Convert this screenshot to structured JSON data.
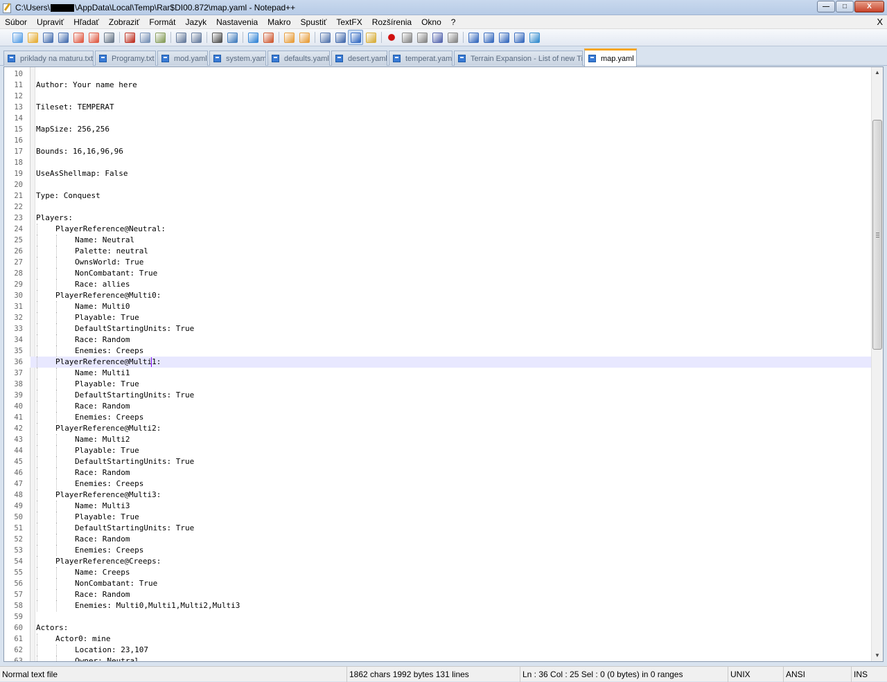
{
  "window": {
    "title_prefix": "C:\\Users\\",
    "title_suffix": "\\AppData\\Local\\Temp\\Rar$DI00.872\\map.yaml - Notepad++",
    "buttons": [
      "—",
      "□",
      "X"
    ]
  },
  "menu": {
    "items": [
      "Súbor",
      "Upraviť",
      "Hľadať",
      "Zobraziť",
      "Formát",
      "Jazyk",
      "Nastavenia",
      "Makro",
      "Spustiť",
      "TextFX",
      "Rozšírenia",
      "Okno",
      "?"
    ],
    "close_label": "X"
  },
  "toolbar": {
    "icons": [
      "new-file-icon",
      "open-file-icon",
      "save-icon",
      "save-all-icon",
      "close-icon",
      "close-all-icon",
      "print-icon",
      "cut-icon",
      "copy-icon",
      "paste-icon",
      "undo-icon",
      "redo-icon",
      "find-icon",
      "replace-icon",
      "zoom-in-icon",
      "zoom-out-icon",
      "sync-vertical-icon",
      "sync-horizontal-icon",
      "word-wrap-icon",
      "show-all-chars-icon",
      "indent-guide-icon",
      "function-list-icon",
      "record-macro-icon",
      "stop-record-icon",
      "play-macro-icon",
      "run-macro-multiple-icon",
      "save-macro-icon",
      "fold-all-icon",
      "prev-bookmark-icon",
      "next-bookmark-icon",
      "unfold-all-icon",
      "spellcheck-icon"
    ],
    "colors": {
      "accent": "#f5a623",
      "tab_icon": "#3a7bd5",
      "current_line": "#e8e8ff",
      "caret": "#8000ff"
    }
  },
  "tabs": [
    {
      "label": "priklady na maturu.txt",
      "active": false
    },
    {
      "label": "Programy.txt",
      "active": false
    },
    {
      "label": "mod.yaml",
      "active": false
    },
    {
      "label": "system.yaml",
      "active": false
    },
    {
      "label": "defaults.yaml",
      "active": false
    },
    {
      "label": "desert.yaml",
      "active": false
    },
    {
      "label": "temperat.yaml",
      "active": false
    },
    {
      "label": "Terrain Expansion - List of new Tilesets.txt",
      "active": false
    },
    {
      "label": "map.yaml",
      "active": true
    }
  ],
  "editor": {
    "current_line": 36,
    "lines": [
      {
        "n": "10",
        "indent": 0,
        "text": ""
      },
      {
        "n": "11",
        "indent": 0,
        "text": "Author: Your name here"
      },
      {
        "n": "12",
        "indent": 0,
        "text": ""
      },
      {
        "n": "13",
        "indent": 0,
        "text": "Tileset: TEMPERAT"
      },
      {
        "n": "14",
        "indent": 0,
        "text": ""
      },
      {
        "n": "15",
        "indent": 0,
        "text": "MapSize: 256,256"
      },
      {
        "n": "16",
        "indent": 0,
        "text": ""
      },
      {
        "n": "17",
        "indent": 0,
        "text": "Bounds: 16,16,96,96"
      },
      {
        "n": "18",
        "indent": 0,
        "text": ""
      },
      {
        "n": "19",
        "indent": 0,
        "text": "UseAsShellmap: False"
      },
      {
        "n": "20",
        "indent": 0,
        "text": ""
      },
      {
        "n": "21",
        "indent": 0,
        "text": "Type: Conquest"
      },
      {
        "n": "22",
        "indent": 0,
        "text": ""
      },
      {
        "n": "23",
        "indent": 0,
        "text": "Players:"
      },
      {
        "n": "24",
        "indent": 1,
        "text": "PlayerReference@Neutral:"
      },
      {
        "n": "25",
        "indent": 2,
        "text": "Name: Neutral"
      },
      {
        "n": "26",
        "indent": 2,
        "text": "Palette: neutral"
      },
      {
        "n": "27",
        "indent": 2,
        "text": "OwnsWorld: True"
      },
      {
        "n": "28",
        "indent": 2,
        "text": "NonCombatant: True"
      },
      {
        "n": "29",
        "indent": 2,
        "text": "Race: allies"
      },
      {
        "n": "30",
        "indent": 1,
        "text": "PlayerReference@Multi0:"
      },
      {
        "n": "31",
        "indent": 2,
        "text": "Name: Multi0"
      },
      {
        "n": "32",
        "indent": 2,
        "text": "Playable: True"
      },
      {
        "n": "33",
        "indent": 2,
        "text": "DefaultStartingUnits: True"
      },
      {
        "n": "34",
        "indent": 2,
        "text": "Race: Random"
      },
      {
        "n": "35",
        "indent": 2,
        "text": "Enemies: Creeps"
      },
      {
        "n": "36",
        "indent": 1,
        "text": "PlayerReference@Multi1:"
      },
      {
        "n": "37",
        "indent": 2,
        "text": "Name: Multi1"
      },
      {
        "n": "38",
        "indent": 2,
        "text": "Playable: True"
      },
      {
        "n": "39",
        "indent": 2,
        "text": "DefaultStartingUnits: True"
      },
      {
        "n": "40",
        "indent": 2,
        "text": "Race: Random"
      },
      {
        "n": "41",
        "indent": 2,
        "text": "Enemies: Creeps"
      },
      {
        "n": "42",
        "indent": 1,
        "text": "PlayerReference@Multi2:"
      },
      {
        "n": "43",
        "indent": 2,
        "text": "Name: Multi2"
      },
      {
        "n": "44",
        "indent": 2,
        "text": "Playable: True"
      },
      {
        "n": "45",
        "indent": 2,
        "text": "DefaultStartingUnits: True"
      },
      {
        "n": "46",
        "indent": 2,
        "text": "Race: Random"
      },
      {
        "n": "47",
        "indent": 2,
        "text": "Enemies: Creeps"
      },
      {
        "n": "48",
        "indent": 1,
        "text": "PlayerReference@Multi3:"
      },
      {
        "n": "49",
        "indent": 2,
        "text": "Name: Multi3"
      },
      {
        "n": "50",
        "indent": 2,
        "text": "Playable: True"
      },
      {
        "n": "51",
        "indent": 2,
        "text": "DefaultStartingUnits: True"
      },
      {
        "n": "52",
        "indent": 2,
        "text": "Race: Random"
      },
      {
        "n": "53",
        "indent": 2,
        "text": "Enemies: Creeps"
      },
      {
        "n": "54",
        "indent": 1,
        "text": "PlayerReference@Creeps:"
      },
      {
        "n": "55",
        "indent": 2,
        "text": "Name: Creeps"
      },
      {
        "n": "56",
        "indent": 2,
        "text": "NonCombatant: True"
      },
      {
        "n": "57",
        "indent": 2,
        "text": "Race: Random"
      },
      {
        "n": "58",
        "indent": 2,
        "text": "Enemies: Multi0,Multi1,Multi2,Multi3"
      },
      {
        "n": "59",
        "indent": 0,
        "text": ""
      },
      {
        "n": "60",
        "indent": 0,
        "text": "Actors:"
      },
      {
        "n": "61",
        "indent": 1,
        "text": "Actor0: mine"
      },
      {
        "n": "62",
        "indent": 2,
        "text": "Location: 23,107"
      },
      {
        "n": "63",
        "indent": 2,
        "text": "Owner: Neutral"
      }
    ]
  },
  "status": {
    "file_type": "Normal text file",
    "length": "1862 chars   1992 bytes   131 lines",
    "position": "Ln : 36    Col : 25    Sel : 0 (0 bytes) in 0 ranges",
    "eol": "UNIX",
    "encoding": "ANSI",
    "mode": "INS"
  }
}
